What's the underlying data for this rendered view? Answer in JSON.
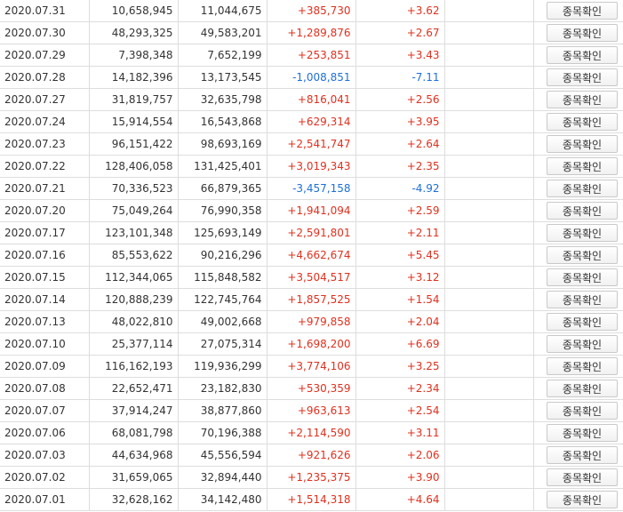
{
  "button_label": "종목확인",
  "colors": {
    "up": "#e0301e",
    "down": "#1e6fd9",
    "text": "#333333"
  },
  "rows": [
    {
      "date": "2020.07.31",
      "v1": "10,658,945",
      "v2": "11,044,675",
      "change": "+385,730",
      "rate": "+3.62",
      "dir": "up"
    },
    {
      "date": "2020.07.30",
      "v1": "48,293,325",
      "v2": "49,583,201",
      "change": "+1,289,876",
      "rate": "+2.67",
      "dir": "up"
    },
    {
      "date": "2020.07.29",
      "v1": "7,398,348",
      "v2": "7,652,199",
      "change": "+253,851",
      "rate": "+3.43",
      "dir": "up"
    },
    {
      "date": "2020.07.28",
      "v1": "14,182,396",
      "v2": "13,173,545",
      "change": "-1,008,851",
      "rate": "-7.11",
      "dir": "down"
    },
    {
      "date": "2020.07.27",
      "v1": "31,819,757",
      "v2": "32,635,798",
      "change": "+816,041",
      "rate": "+2.56",
      "dir": "up"
    },
    {
      "date": "2020.07.24",
      "v1": "15,914,554",
      "v2": "16,543,868",
      "change": "+629,314",
      "rate": "+3.95",
      "dir": "up"
    },
    {
      "date": "2020.07.23",
      "v1": "96,151,422",
      "v2": "98,693,169",
      "change": "+2,541,747",
      "rate": "+2.64",
      "dir": "up"
    },
    {
      "date": "2020.07.22",
      "v1": "128,406,058",
      "v2": "131,425,401",
      "change": "+3,019,343",
      "rate": "+2.35",
      "dir": "up"
    },
    {
      "date": "2020.07.21",
      "v1": "70,336,523",
      "v2": "66,879,365",
      "change": "-3,457,158",
      "rate": "-4.92",
      "dir": "down"
    },
    {
      "date": "2020.07.20",
      "v1": "75,049,264",
      "v2": "76,990,358",
      "change": "+1,941,094",
      "rate": "+2.59",
      "dir": "up"
    },
    {
      "date": "2020.07.17",
      "v1": "123,101,348",
      "v2": "125,693,149",
      "change": "+2,591,801",
      "rate": "+2.11",
      "dir": "up"
    },
    {
      "date": "2020.07.16",
      "v1": "85,553,622",
      "v2": "90,216,296",
      "change": "+4,662,674",
      "rate": "+5.45",
      "dir": "up"
    },
    {
      "date": "2020.07.15",
      "v1": "112,344,065",
      "v2": "115,848,582",
      "change": "+3,504,517",
      "rate": "+3.12",
      "dir": "up"
    },
    {
      "date": "2020.07.14",
      "v1": "120,888,239",
      "v2": "122,745,764",
      "change": "+1,857,525",
      "rate": "+1.54",
      "dir": "up"
    },
    {
      "date": "2020.07.13",
      "v1": "48,022,810",
      "v2": "49,002,668",
      "change": "+979,858",
      "rate": "+2.04",
      "dir": "up"
    },
    {
      "date": "2020.07.10",
      "v1": "25,377,114",
      "v2": "27,075,314",
      "change": "+1,698,200",
      "rate": "+6.69",
      "dir": "up"
    },
    {
      "date": "2020.07.09",
      "v1": "116,162,193",
      "v2": "119,936,299",
      "change": "+3,774,106",
      "rate": "+3.25",
      "dir": "up"
    },
    {
      "date": "2020.07.08",
      "v1": "22,652,471",
      "v2": "23,182,830",
      "change": "+530,359",
      "rate": "+2.34",
      "dir": "up"
    },
    {
      "date": "2020.07.07",
      "v1": "37,914,247",
      "v2": "38,877,860",
      "change": "+963,613",
      "rate": "+2.54",
      "dir": "up"
    },
    {
      "date": "2020.07.06",
      "v1": "68,081,798",
      "v2": "70,196,388",
      "change": "+2,114,590",
      "rate": "+3.11",
      "dir": "up"
    },
    {
      "date": "2020.07.03",
      "v1": "44,634,968",
      "v2": "45,556,594",
      "change": "+921,626",
      "rate": "+2.06",
      "dir": "up"
    },
    {
      "date": "2020.07.02",
      "v1": "31,659,065",
      "v2": "32,894,440",
      "change": "+1,235,375",
      "rate": "+3.90",
      "dir": "up"
    },
    {
      "date": "2020.07.01",
      "v1": "32,628,162",
      "v2": "34,142,480",
      "change": "+1,514,318",
      "rate": "+4.64",
      "dir": "up"
    }
  ]
}
